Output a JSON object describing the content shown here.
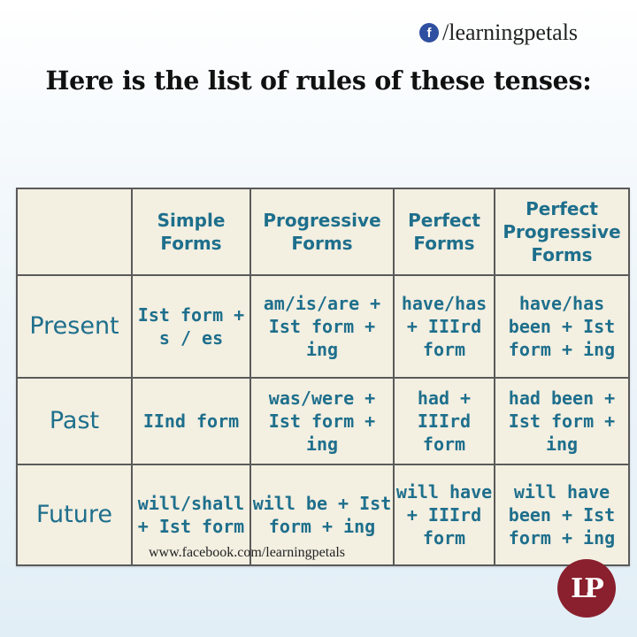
{
  "brand": {
    "icon": "facebook-icon",
    "handle": "/learningpetals"
  },
  "title": "Here is the list of rules of these tenses:",
  "table": {
    "headers": [
      "",
      "Simple Forms",
      "Progressive Forms",
      "Perfect Forms",
      "Perfect Progressive Forms"
    ],
    "rows": [
      {
        "label": "Present",
        "cells": [
          "Ist form + s / es",
          "am/is/are + Ist form + ing",
          "have/has + IIIrd form",
          "have/has been + Ist form + ing"
        ]
      },
      {
        "label": "Past",
        "cells": [
          "IInd form",
          "was/were + Ist form + ing",
          "had + IIIrd form",
          "had been + Ist form + ing"
        ]
      },
      {
        "label": "Future",
        "cells": [
          "will/shall + Ist form",
          "will be + Ist form + ing",
          "will have + IIIrd form",
          "will have been + Ist form + ing"
        ]
      }
    ]
  },
  "watermark": "www.facebook.com/learningpetals",
  "logo": {
    "text": "LP",
    "color": "#8a1f2d"
  },
  "colors": {
    "cell_text": "#1e6f8c",
    "table_bg": "#f3efe1",
    "border": "#5a5a5a"
  }
}
